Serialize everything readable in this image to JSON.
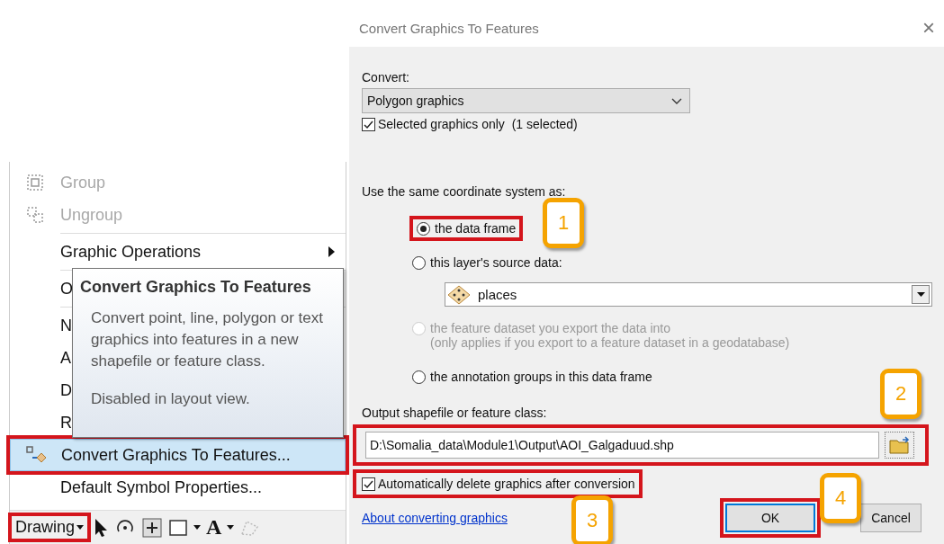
{
  "menu": {
    "items": [
      {
        "kind": "item",
        "label": "Group",
        "disabled": true,
        "selected": false
      },
      {
        "kind": "item",
        "label": "Ungroup",
        "disabled": true,
        "selected": false
      },
      {
        "kind": "separator"
      },
      {
        "kind": "submenu",
        "label": "Graphic Operations",
        "disabled": false,
        "selected": false
      },
      {
        "kind": "separator"
      },
      {
        "kind": "item",
        "label": "O",
        "disabled": false,
        "selected": false
      },
      {
        "kind": "separator"
      },
      {
        "kind": "item",
        "label": "N",
        "disabled": false,
        "selected": false
      },
      {
        "kind": "item",
        "label": "A",
        "disabled": false,
        "selected": false
      },
      {
        "kind": "item",
        "label": "D",
        "disabled": false,
        "selected": false
      },
      {
        "kind": "item",
        "label": "R",
        "disabled": false,
        "selected": false
      },
      {
        "kind": "item",
        "label": "Convert Graphics To Features...",
        "disabled": false,
        "selected": true,
        "outlined": true
      },
      {
        "kind": "item",
        "label": "Default Symbol Properties...",
        "disabled": false,
        "selected": false
      }
    ]
  },
  "tooltip": {
    "title": "Convert Graphics To Features",
    "body": "Convert point, line, polygon or text graphics into features in a new shapefile or feature class.",
    "note": "Disabled in layout view."
  },
  "toolbar": {
    "drawing_button": {
      "label": "Drawing",
      "outlined": true
    },
    "text_tool": "A"
  },
  "dialog": {
    "title": "Convert Graphics To Features",
    "close": "×",
    "convert_label": "Convert:",
    "convert_select": "Polygon graphics",
    "selected_only": {
      "label": "Selected graphics only  (1 selected)",
      "checked": true
    },
    "coord_label": "Use the same coordinate system as:",
    "coord_options": [
      {
        "label": "the data frame",
        "selected": true,
        "disabled": false,
        "outlined": true
      },
      {
        "label": "this layer's source data:",
        "selected": false,
        "disabled": false,
        "dropdown": "places"
      },
      {
        "label": "the feature dataset you export the data into",
        "note": "(only applies if you export to a feature dataset in a geodatabase)",
        "selected": false,
        "disabled": true
      },
      {
        "label": "the annotation groups in this data frame",
        "selected": false,
        "disabled": false
      }
    ],
    "output_label": "Output shapefile or feature class:",
    "output_path": "D:\\Somalia_data\\Module1\\Output\\AOI_Galgaduud.shp",
    "output_outlined": true,
    "auto_delete": {
      "label": "Automatically delete graphics after conversion",
      "checked": true,
      "outlined": true
    },
    "help_link": "About converting graphics",
    "ok": {
      "label": "OK",
      "outlined": true
    },
    "cancel": {
      "label": "Cancel"
    }
  },
  "badges": [
    {
      "label": "1"
    },
    {
      "label": "2"
    },
    {
      "label": "3"
    },
    {
      "label": "4"
    }
  ]
}
